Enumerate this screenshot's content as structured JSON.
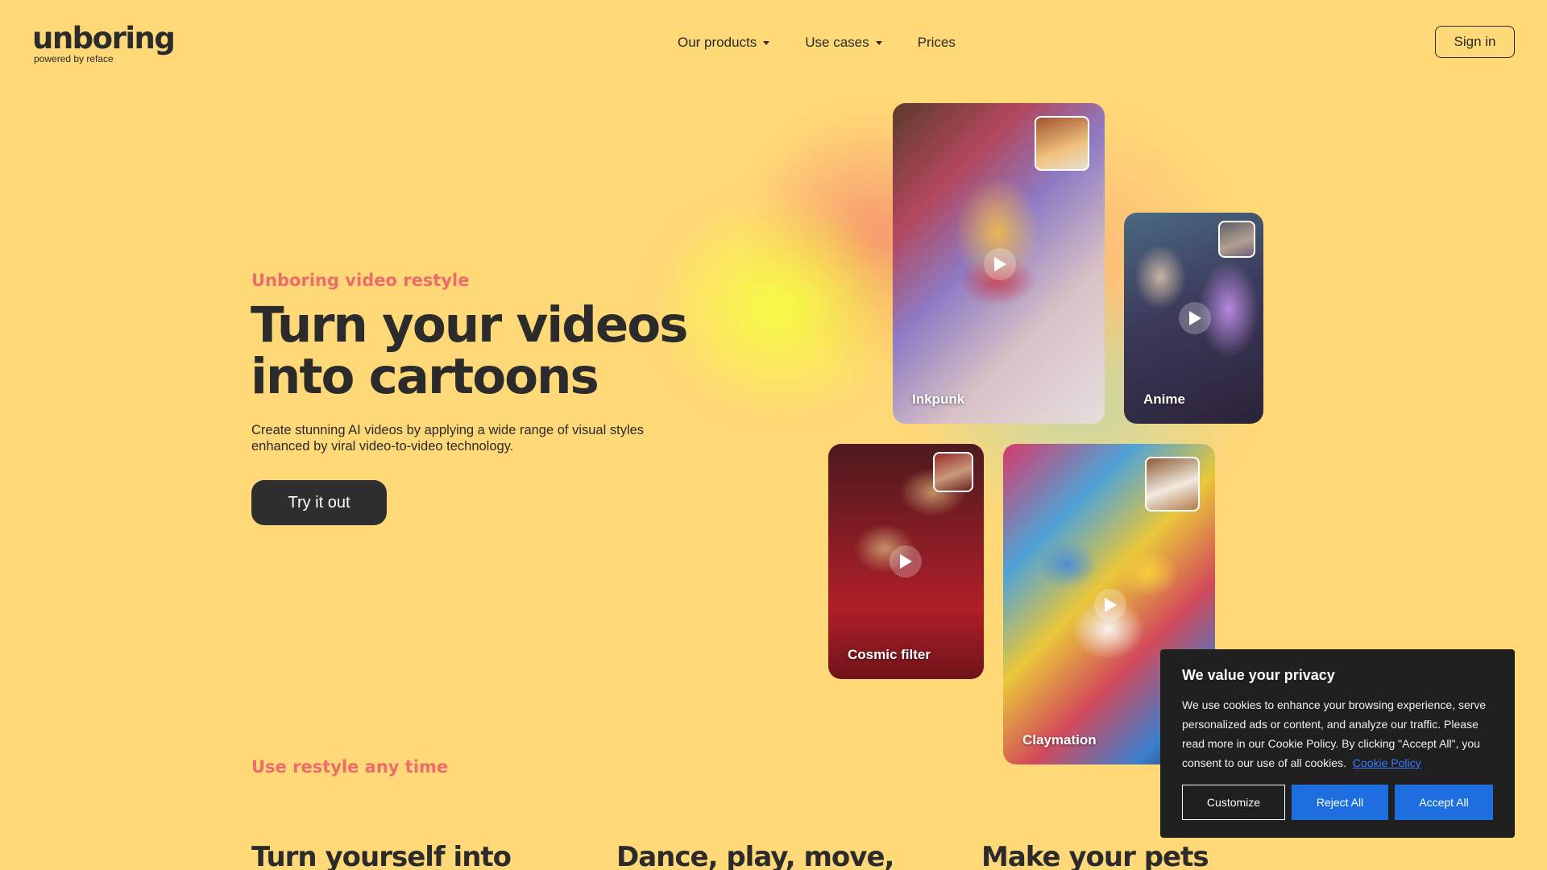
{
  "header": {
    "logo_text": "unboring",
    "logo_subtitle": "powered by reface",
    "nav": [
      {
        "label": "Our products",
        "has_dropdown": true
      },
      {
        "label": "Use cases",
        "has_dropdown": true
      },
      {
        "label": "Prices",
        "has_dropdown": false
      }
    ],
    "signin_label": "Sign in"
  },
  "hero": {
    "eyebrow": "Unboring video restyle",
    "title_line1": "Turn your videos",
    "title_line2": "into cartoons",
    "description": "Create stunning AI videos by applying a wide range of visual styles enhanced by viral video-to-video technology.",
    "cta_label": "Try it out"
  },
  "style_cards": [
    {
      "label": "Inkpunk",
      "icon": "play-icon"
    },
    {
      "label": "Anime",
      "icon": "play-icon"
    },
    {
      "label": "Cosmic filter",
      "icon": "play-icon"
    },
    {
      "label": "Claymation",
      "icon": "play-icon"
    }
  ],
  "section": {
    "eyebrow": "Use restyle any time",
    "features": [
      {
        "title": "Turn yourself into"
      },
      {
        "title": "Dance, play, move,"
      },
      {
        "title": "Make your pets"
      }
    ]
  },
  "cookie_banner": {
    "title": "We value your privacy",
    "text": "We use cookies to enhance your browsing experience, serve personalized ads or content, and analyze our traffic. Please read more in our Cookie Policy. By clicking \"Accept All\", you consent to our use of all cookies.",
    "policy_link": "Cookie Policy",
    "customize_label": "Customize",
    "reject_label": "Reject All",
    "accept_label": "Accept All"
  },
  "colors": {
    "background": "#ffd877",
    "accent": "#ee6b6b",
    "dark": "#2b2b2b",
    "cookie_bg": "#1f1f1f",
    "cookie_button": "#1d6fe0"
  }
}
